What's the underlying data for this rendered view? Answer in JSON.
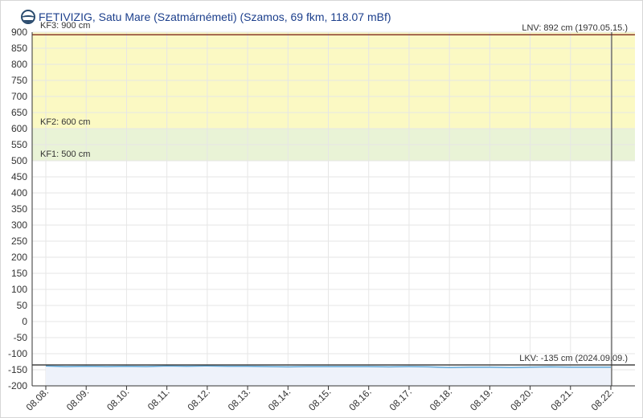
{
  "header": {
    "title": "FETIVIZIG, Satu Mare (Szatmárnémeti) (Szamos, 69 fkm, 118.07 mBf)"
  },
  "chart_data": {
    "type": "line",
    "ylim": [
      -200,
      900
    ],
    "y_ticks": [
      900,
      850,
      800,
      750,
      700,
      650,
      600,
      550,
      500,
      450,
      400,
      350,
      300,
      250,
      200,
      150,
      100,
      50,
      0,
      -50,
      -100,
      -150,
      -200
    ],
    "x_ticks": [
      "08.08.",
      "08.09.",
      "08.10.",
      "08.11.",
      "08.12.",
      "08.13.",
      "08.14.",
      "08.15.",
      "08.16.",
      "08.17.",
      "08.18.",
      "08.19.",
      "08.20.",
      "08.21.",
      "08.22."
    ],
    "grid": true,
    "bands": [
      {
        "label": "KF3: 900 cm",
        "from": 600,
        "to": 900,
        "color": "#fbf9c3"
      },
      {
        "label": "KF2: 600 cm",
        "from": 500,
        "to": 600,
        "color": "#e9f3d6"
      },
      {
        "label": "KF1: 500 cm",
        "from": 500,
        "to": 500,
        "color": "#e9f3d6"
      }
    ],
    "ref_lines": [
      {
        "label": "LNV: 892 cm (1970.05.15.)",
        "value": 892,
        "color": "#8b3a2a"
      },
      {
        "label": "LKV: -135 cm (2024.09.09.)",
        "value": -135,
        "color": "#444444"
      }
    ],
    "series": [
      {
        "color": "#5fa8d8",
        "x": [
          0,
          0.5,
          1,
          1.5,
          2,
          2.5,
          3,
          3.5,
          4,
          4.5,
          5,
          5.5,
          6,
          6.5,
          7,
          7.5,
          8,
          8.5,
          9,
          9.5,
          10,
          10.5,
          11,
          11.5,
          12,
          12.5,
          13,
          13.5,
          14
        ],
        "values": [
          -138,
          -140,
          -139,
          -140,
          -139,
          -140,
          -138,
          -139,
          -138,
          -139,
          -139,
          -140,
          -141,
          -140,
          -140,
          -140,
          -140,
          -141,
          -140,
          -141,
          -143,
          -142,
          -142,
          -143,
          -142,
          -141,
          -142,
          -142,
          -142
        ]
      }
    ],
    "current_marker_x": 14
  },
  "colors": {
    "grid": "#e6e6e6",
    "axis": "#333333",
    "area_fill": "#eef2fa"
  }
}
